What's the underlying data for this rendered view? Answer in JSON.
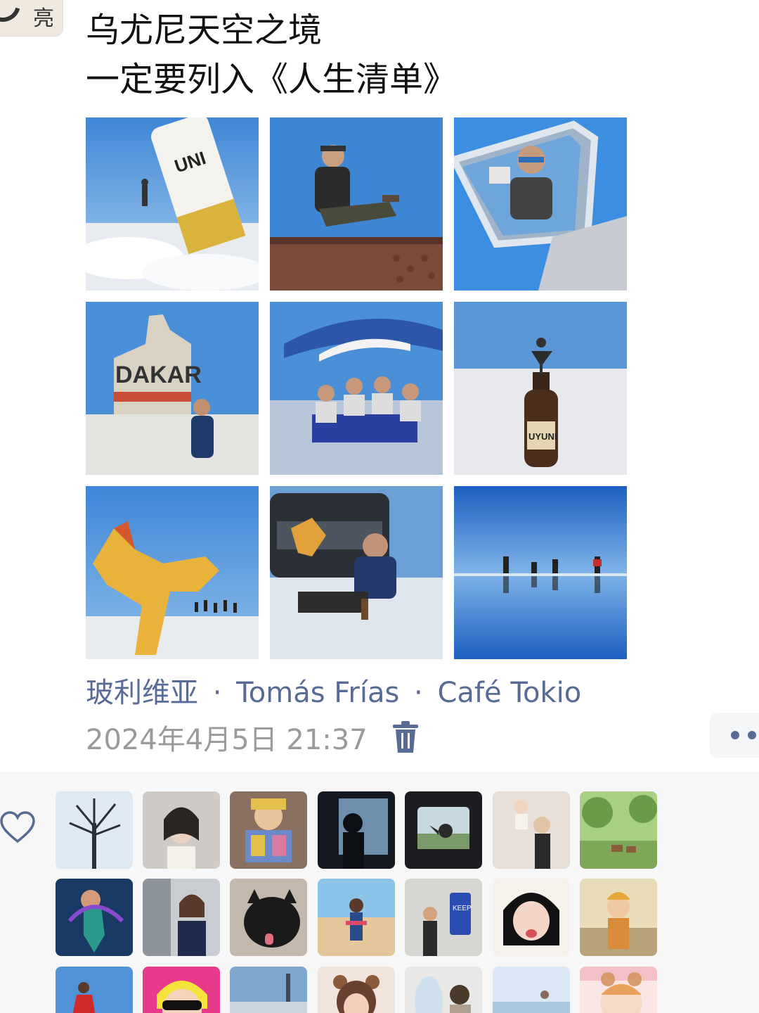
{
  "post": {
    "author_avatar_glyph": "亮",
    "text_line1": "乌尤尼天空之境",
    "text_line2": "一定要列入《人生清单》",
    "photos": [
      {
        "name": "photo-beer-can-perspective"
      },
      {
        "name": "photo-man-sitting-on-rusty-train"
      },
      {
        "name": "photo-selfie-in-car-mirror"
      },
      {
        "name": "photo-dakar-monument"
      },
      {
        "name": "photo-group-picnic-under-umbrella"
      },
      {
        "name": "photo-person-on-beer-bottle"
      },
      {
        "name": "photo-toy-dinosaur-perspective"
      },
      {
        "name": "photo-man-with-dinosaur-by-car"
      },
      {
        "name": "photo-group-mirror-reflection"
      }
    ],
    "location": {
      "part1": "玻利维亚",
      "separator": "·",
      "part2": "Tomás Frías",
      "part3": "Café Tokio"
    },
    "timestamp": "2024年4月5日 21:37",
    "icons": {
      "delete": "trash-icon",
      "more": "more-dots-icon",
      "like": "heart-icon"
    }
  },
  "likes": {
    "avatar_names": [
      "like-avatar-bare-tree",
      "like-avatar-portrait-woman",
      "like-avatar-woman-with-book",
      "like-avatar-silhouette-window",
      "like-avatar-train-window",
      "like-avatar-woman-lifting-baby",
      "like-avatar-green-landscape-deer",
      "like-avatar-mermaid",
      "like-avatar-woman-office",
      "like-avatar-black-cat",
      "like-avatar-beach-woman",
      "like-avatar-keep-right-sign",
      "like-avatar-anime-girl",
      "like-avatar-illustrated-girl",
      "like-avatar-woman-red-dress",
      "like-avatar-cartoon-sunglasses",
      "like-avatar-city-skyline",
      "like-avatar-bear-ears-girl",
      "like-avatar-airplane-window",
      "like-avatar-beach-sky",
      "like-avatar-cartoon-bear-girl"
    ]
  },
  "colors": {
    "link": "#576b95",
    "timestamp": "#9a9a9a",
    "likes_bg": "#f7f7f7",
    "sky": "#4d8fd6",
    "salt": "#f2f4f7"
  }
}
